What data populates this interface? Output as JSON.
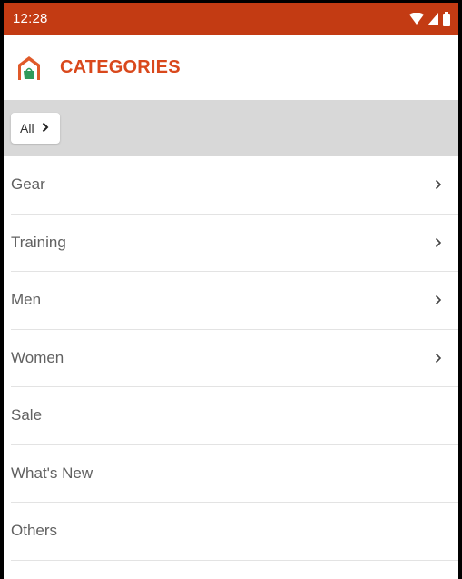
{
  "status_bar": {
    "time": "12:28",
    "icons": [
      "wifi-icon",
      "cell-signal-icon",
      "battery-icon"
    ],
    "color": "#c33b13"
  },
  "header": {
    "logo": "store-logo-icon",
    "title": "CATEGORIES",
    "title_color": "#d9481c"
  },
  "breadcrumb": {
    "label": "All",
    "icon": "chevron-right-icon"
  },
  "categories": [
    {
      "label": "Gear",
      "has_children": true
    },
    {
      "label": "Training",
      "has_children": true
    },
    {
      "label": "Men",
      "has_children": true
    },
    {
      "label": "Women",
      "has_children": true
    },
    {
      "label": "Sale",
      "has_children": false
    },
    {
      "label": "What's New",
      "has_children": false
    },
    {
      "label": "Others",
      "has_children": false
    }
  ]
}
